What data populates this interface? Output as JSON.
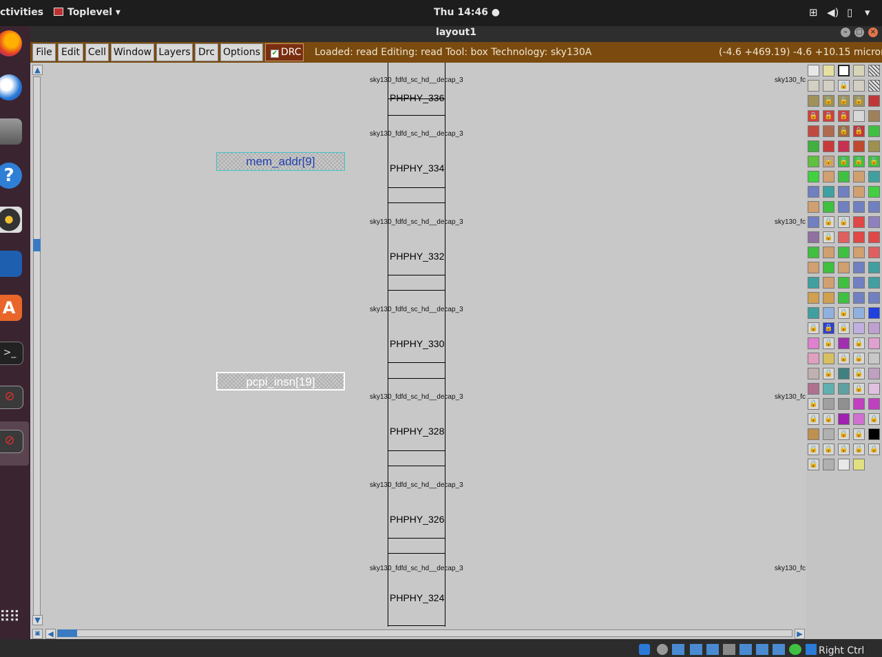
{
  "topbar": {
    "activities": "ctivities",
    "app_menu": "Toplevel ▾",
    "clock": "Thu 14:46 ●",
    "tray_icons": [
      "network-icon",
      "volume-icon",
      "battery-icon",
      "chevron-down-icon"
    ]
  },
  "dock": {
    "items": [
      "firefox-icon",
      "thunderbird-icon",
      "files-icon",
      "help-icon",
      "rhythmbox-icon",
      "libreoffice-impress-icon",
      "app-center-icon",
      "terminal-icon",
      "disabled-app-icon",
      "disabled-app-icon",
      "show-apps-icon"
    ]
  },
  "window": {
    "title": "layout1"
  },
  "menubar": {
    "items": [
      "File",
      "Edit",
      "Cell",
      "Window",
      "Layers",
      "Drc",
      "Options"
    ],
    "drc_label": "DRC",
    "status": "Loaded: read Editing: read Tool: box  Technology: sky130A",
    "coords": "(-4.6 +469.19) -4.6 +10.15 microns"
  },
  "canvas": {
    "cells": [
      {
        "cell": "sky130_fdfd_sc_hd__decap_3",
        "inst": "PHPHY_336"
      },
      {
        "cell": "sky130_fdfd_sc_hd__decap_3",
        "inst": "PHPHY_334"
      },
      {
        "cell": "sky130_fdfd_sc_hd__decap_3",
        "inst": "PHPHY_332"
      },
      {
        "cell": "sky130_fdfd_sc_hd__decap_3",
        "inst": "PHPHY_330"
      },
      {
        "cell": "sky130_fdfd_sc_hd__decap_3",
        "inst": "PHPHY_328"
      },
      {
        "cell": "sky130_fdfd_sc_hd__decap_3",
        "inst": "PHPHY_326"
      },
      {
        "cell": "sky130_fdfd_sc_hd__decap_3",
        "inst": "PHPHY_324"
      }
    ],
    "right_labels": [
      "sky130_fc",
      "sky130_fc",
      "sky130_fc",
      "sky130_fc"
    ],
    "pins": [
      {
        "name": "mem_addr[9]",
        "color": "#2040b0",
        "border": "#40c0c8"
      },
      {
        "name": "pcpi_insn[19]",
        "color": "#ffffff",
        "border": "#ffffff"
      }
    ]
  },
  "bottombar": {
    "right_ctrl": "Right Ctrl"
  }
}
